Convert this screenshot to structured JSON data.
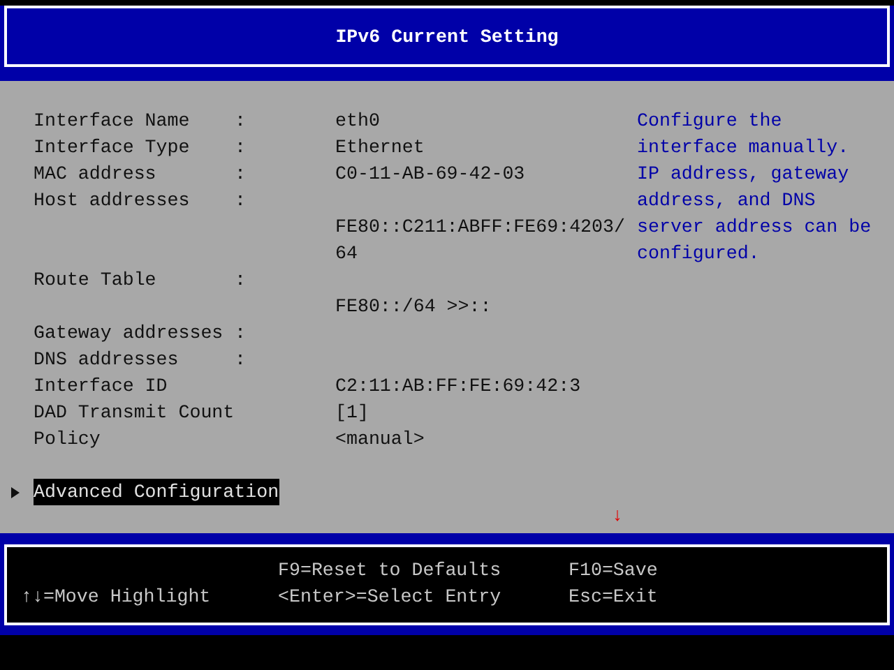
{
  "title": "IPv6 Current Setting",
  "fields": [
    {
      "label": "Interface Name",
      "separator": ":",
      "value": "eth0"
    },
    {
      "label": "Interface Type",
      "separator": ":",
      "value": "Ethernet"
    },
    {
      "label": "MAC address",
      "separator": ":",
      "value": "C0-11-AB-69-42-03"
    },
    {
      "label": "Host addresses",
      "separator": ":",
      "lines": [
        "FE80::C211:ABFF:FE69:4203/",
        "64"
      ]
    },
    {
      "label": "Route Table",
      "separator": ":",
      "lines": [
        "FE80::/64 >>::"
      ]
    },
    {
      "label": "Gateway addresses",
      "separator": ":"
    },
    {
      "label": "DNS addresses",
      "separator": ":"
    },
    {
      "label": "Interface ID",
      "value": "C2:11:AB:FF:FE:69:42:3"
    },
    {
      "label": "DAD Transmit Count",
      "value": "[1]"
    },
    {
      "label": "Policy",
      "value": "<manual>"
    }
  ],
  "menu": [
    {
      "label": "Advanced Configuration",
      "selected": true
    }
  ],
  "help": [
    "Configure the",
    "interface manually.",
    "IP address, gateway",
    "address, and DNS",
    "server address can be",
    "configured."
  ],
  "scroll_indicator": "↓",
  "footer": [
    [
      "↑↓=Move Highlight"
    ],
    [
      "F9=Reset to Defaults",
      "<Enter>=Select Entry"
    ],
    [
      "F10=Save",
      "Esc=Exit"
    ]
  ]
}
